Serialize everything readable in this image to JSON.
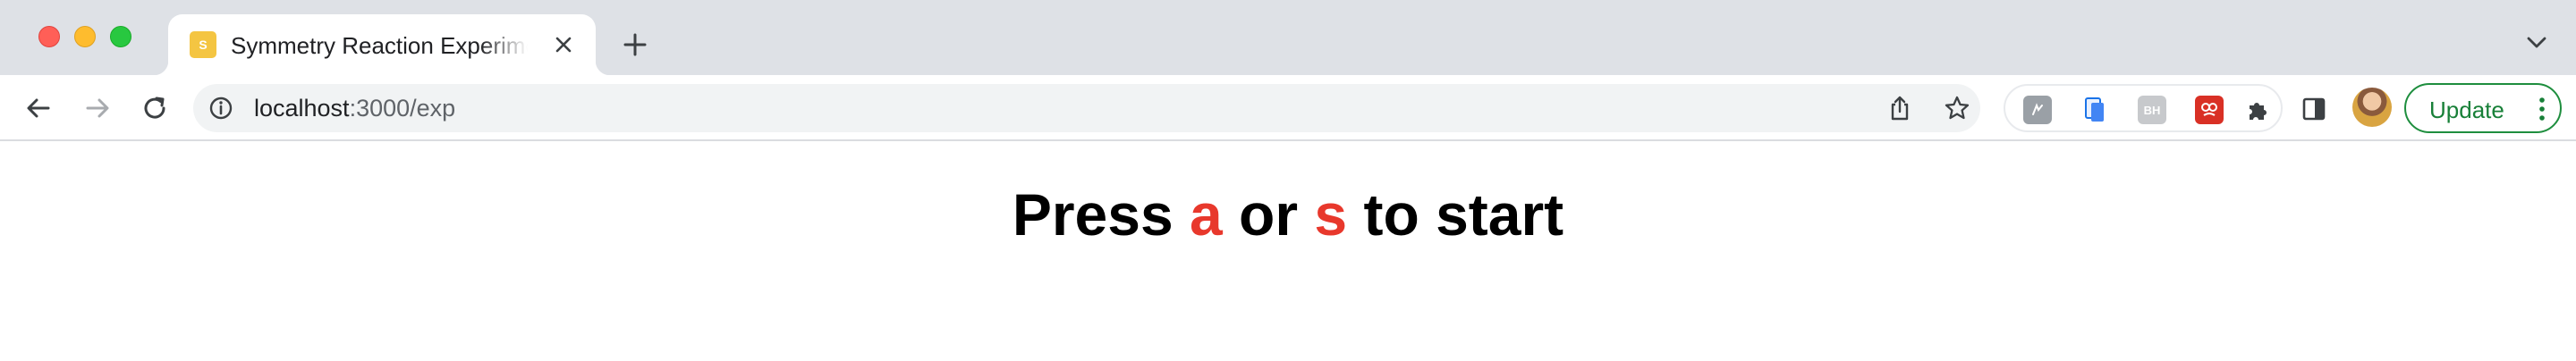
{
  "browser": {
    "tab": {
      "favicon_letter": "S",
      "favicon_color": "#f4c542",
      "title": "Symmetry Reaction Experiment"
    },
    "icons": {
      "close": "close-icon",
      "new_tab": "plus-icon",
      "tab_search": "chevron-down-icon",
      "back": "arrow-left-icon",
      "forward": "arrow-right-icon",
      "reload": "reload-icon",
      "site_info": "info-icon",
      "share": "share-icon",
      "bookmark": "star-icon",
      "extensions": "puzzle-icon",
      "side_panel": "side-panel-icon",
      "menu": "kebab-menu-icon"
    },
    "address_bar": {
      "host": "localhost",
      "path": ":3000/exp"
    },
    "extensions": [
      {
        "name": "extension-1",
        "label": "",
        "color": "#9aa0a6"
      },
      {
        "name": "extension-2",
        "label": "",
        "color": "#4285f4"
      },
      {
        "name": "extension-3",
        "label": "BH",
        "color": "#c7c9cc"
      },
      {
        "name": "extension-4",
        "label": "",
        "color": "#d93025"
      }
    ],
    "update_button": {
      "label": "Update",
      "color": "#188038"
    }
  },
  "page": {
    "instruction": {
      "prefix": "Press ",
      "key1": "a",
      "middle": " or ",
      "key2": "s",
      "suffix": " to start"
    },
    "key_color": "#e8382c"
  }
}
